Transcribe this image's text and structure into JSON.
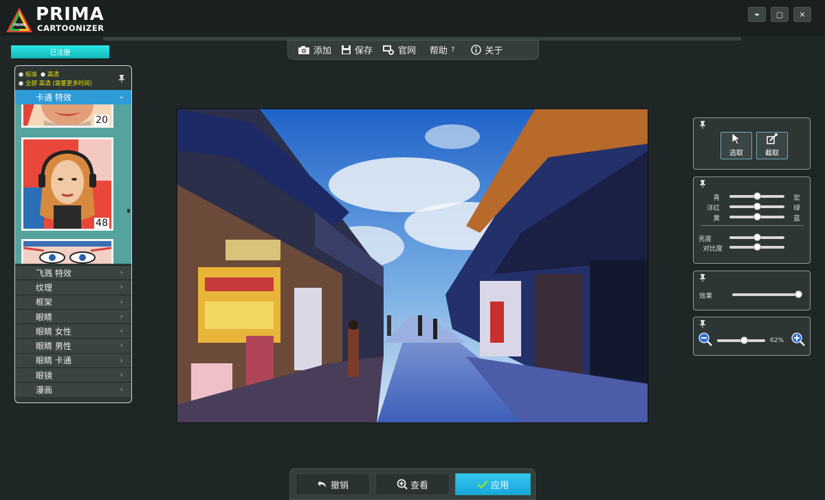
{
  "app": {
    "logo_top": "PRIMA",
    "logo_bottom": "CARTOONIZER",
    "logo_small": "PRIMA"
  },
  "window_controls": {
    "minimize": "▬",
    "maximize": "▢",
    "close": "✕"
  },
  "registered_label": "已注册",
  "toolbar": {
    "add": "添加",
    "save": "保存",
    "website": "官网",
    "help": "帮助",
    "help_mark": "?",
    "about": "关于"
  },
  "left_panel": {
    "mode_standard": "标准",
    "mode_hd": "高清",
    "mode_all_hd": "全部 高清 (需要更多时间)",
    "category_title": "卡通 特效",
    "thumbnails": [
      {
        "number": "20"
      },
      {
        "number": "48"
      }
    ],
    "categories": [
      "飞溅 特效",
      "纹理",
      "框架",
      "眼睛",
      "眼睛 女性",
      "眼睛 男性",
      "眼睛 卡通",
      "眼镜",
      "漫画"
    ]
  },
  "right_panels": {
    "select_label": "选取",
    "crop_label": "截取",
    "color": {
      "rows": [
        {
          "left": "青",
          "right": "宏",
          "value": 0.5
        },
        {
          "left": "洋红",
          "right": "绿",
          "value": 0.5
        },
        {
          "left": "黄",
          "right": "蓝",
          "value": 0.5
        }
      ],
      "brightness_label": "亮度",
      "brightness": 0.5,
      "contrast_label": "对比度",
      "contrast": 0.5
    },
    "effect": {
      "label": "效果",
      "value": 1.0
    },
    "zoom": {
      "value_label": "62%",
      "value": 0.57
    }
  },
  "bottom_bar": {
    "undo": "撤销",
    "view": "查看",
    "apply": "应用"
  },
  "colors": {
    "accent_cyan": "#1fcfcf",
    "category_blue": "#2e9bd6",
    "apply_blue": "#23b3e6",
    "thumb_bg": "#54a39c"
  }
}
